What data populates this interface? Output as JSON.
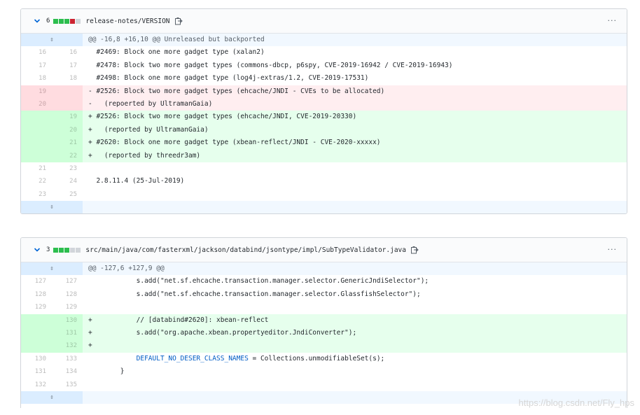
{
  "files": [
    {
      "count": "6",
      "stat_colors": [
        "#2cbe4e",
        "#2cbe4e",
        "#2cbe4e",
        "#cb2431",
        "#d1d5da"
      ],
      "path": "release-notes/VERSION",
      "more": "···",
      "hunk_header": "@@ -16,8 +16,10 @@ Unreleased but backported",
      "expand_glyph": "⇳",
      "lines": [
        {
          "type": "ctx",
          "old": "16",
          "new": "16",
          "text": "  #2469: Block one more gadget type (xalan2)"
        },
        {
          "type": "ctx",
          "old": "17",
          "new": "17",
          "text": "  #2478: Block two more gadget types (commons-dbcp, p6spy, CVE-2019-16942 / CVE-2019-16943)"
        },
        {
          "type": "ctx",
          "old": "18",
          "new": "18",
          "text": "  #2498: Block one more gadget type (log4j-extras/1.2, CVE-2019-17531)"
        },
        {
          "type": "del",
          "old": "19",
          "new": "",
          "text": "- #2526: Block two more gadget types (ehcache/JNDI - CVEs to be allocated)"
        },
        {
          "type": "del",
          "old": "20",
          "new": "",
          "text": "-   (repoerted by UltramanGaia)"
        },
        {
          "type": "add",
          "old": "",
          "new": "19",
          "text": "+ #2526: Block two more gadget types (ehcache/JNDI, CVE-2019-20330)"
        },
        {
          "type": "add",
          "old": "",
          "new": "20",
          "text": "+   (reported by UltramanGaia)"
        },
        {
          "type": "add",
          "old": "",
          "new": "21",
          "text": "+ #2620: Block one more gadget type (xbean-reflect/JNDI - CVE-2020-xxxxx)"
        },
        {
          "type": "add",
          "old": "",
          "new": "22",
          "text": "+   (reported by threedr3am)"
        },
        {
          "type": "ctx",
          "old": "21",
          "new": "23",
          "text": ""
        },
        {
          "type": "ctx",
          "old": "22",
          "new": "24",
          "text": "  2.8.11.4 (25-Jul-2019)"
        },
        {
          "type": "ctx",
          "old": "23",
          "new": "25",
          "text": ""
        }
      ]
    },
    {
      "count": "3",
      "stat_colors": [
        "#2cbe4e",
        "#2cbe4e",
        "#2cbe4e",
        "#d1d5da",
        "#d1d5da"
      ],
      "path": "src/main/java/com/fasterxml/jackson/databind/jsontype/impl/SubTypeValidator.java",
      "more": "···",
      "hunk_header": "@@ -127,6 +127,9 @@",
      "expand_glyph": "⇳",
      "lines": [
        {
          "type": "ctx",
          "old": "127",
          "new": "127",
          "text": "            s.add(\"net.sf.ehcache.transaction.manager.selector.GenericJndiSelector\");"
        },
        {
          "type": "ctx",
          "old": "128",
          "new": "128",
          "text": "            s.add(\"net.sf.ehcache.transaction.manager.selector.GlassfishSelector\");"
        },
        {
          "type": "ctx",
          "old": "129",
          "new": "129",
          "text": ""
        },
        {
          "type": "add",
          "old": "",
          "new": "130",
          "text": "+           // [databind#2620]: xbean-reflect"
        },
        {
          "type": "add",
          "old": "",
          "new": "131",
          "text": "+           s.add(\"org.apache.xbean.propertyeditor.JndiConverter\");"
        },
        {
          "type": "add",
          "old": "",
          "new": "132",
          "text": "+"
        },
        {
          "type": "ctx",
          "old": "130",
          "new": "133",
          "text": "            DEFAULT_NO_DESER_CLASS_NAMES = Collections.unmodifiableSet(s);"
        },
        {
          "type": "ctx",
          "old": "131",
          "new": "134",
          "text": "        }"
        },
        {
          "type": "ctx",
          "old": "132",
          "new": "135",
          "text": ""
        }
      ]
    }
  ],
  "watermark": "https://blog.csdn.net/Fly_hps"
}
